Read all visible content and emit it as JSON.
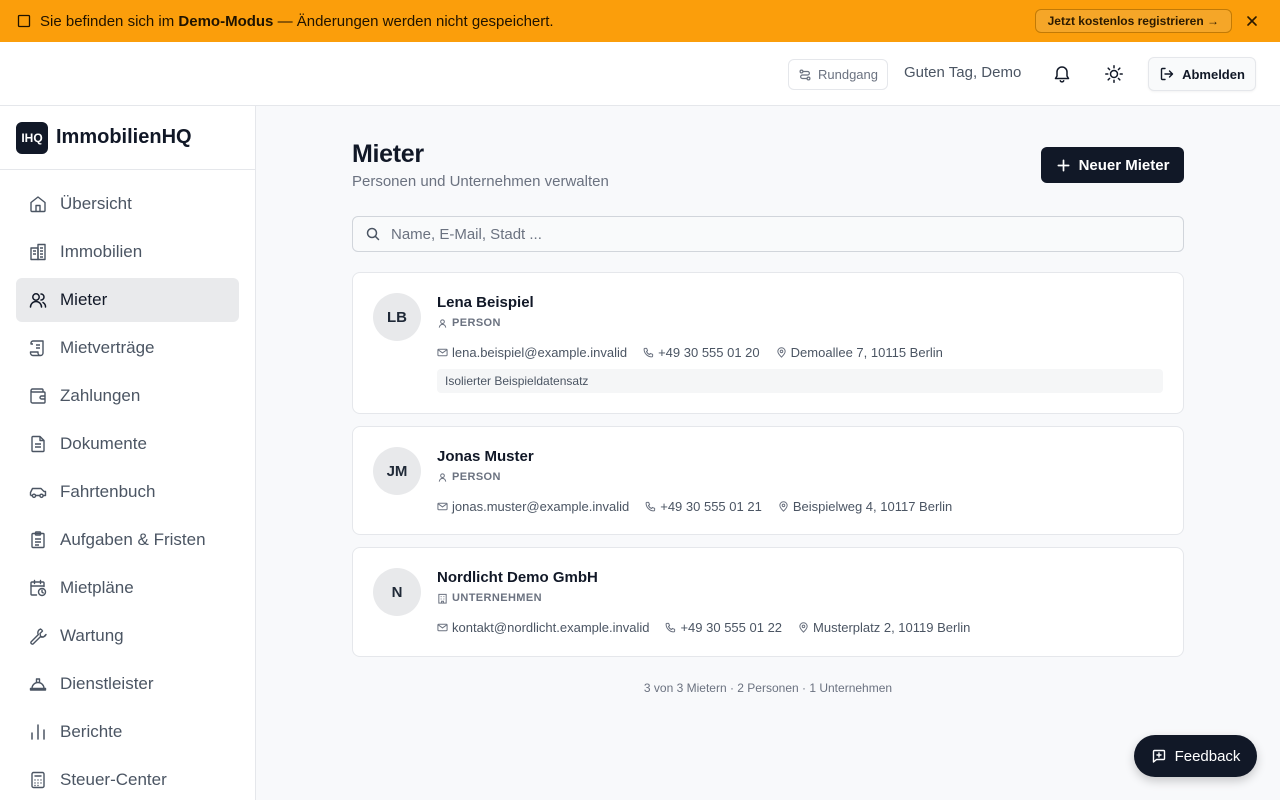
{
  "banner": {
    "prefix": "Sie befinden sich im ",
    "mode": "Demo-Modus",
    "suffix": " — Änderungen werden nicht gespeichert.",
    "cta": "Jetzt kostenlos registrieren →"
  },
  "header": {
    "tour": "Rundgang",
    "greeting": "Guten Tag, Demo",
    "logout": "Abmelden"
  },
  "sidebar": {
    "logo": "IHQ",
    "brand": "ImmobilienHQ",
    "items": [
      {
        "label": "Übersicht",
        "icon": "home-icon"
      },
      {
        "label": "Immobilien",
        "icon": "building-icon"
      },
      {
        "label": "Mieter",
        "icon": "users-icon",
        "active": true
      },
      {
        "label": "Mietverträge",
        "icon": "scroll-icon"
      },
      {
        "label": "Zahlungen",
        "icon": "wallet-icon"
      },
      {
        "label": "Dokumente",
        "icon": "file-icon"
      },
      {
        "label": "Fahrtenbuch",
        "icon": "car-icon"
      },
      {
        "label": "Aufgaben & Fristen",
        "icon": "clipboard-icon"
      },
      {
        "label": "Mietpläne",
        "icon": "calendar-clock-icon"
      },
      {
        "label": "Wartung",
        "icon": "wrench-icon"
      },
      {
        "label": "Dienstleister",
        "icon": "hardhat-icon"
      },
      {
        "label": "Berichte",
        "icon": "chart-icon"
      },
      {
        "label": "Steuer-Center",
        "icon": "calculator-icon"
      }
    ]
  },
  "main": {
    "title": "Mieter",
    "subtitle": "Personen und Unternehmen verwalten",
    "new_button": "Neuer Mieter",
    "search_placeholder": "Name, E-Mail, Stadt ...",
    "tenants": [
      {
        "initials": "LB",
        "name": "Lena Beispiel",
        "type": "PERSON",
        "email": "lena.beispiel@example.invalid",
        "phone": "+49 30 555 01 20",
        "address": "Demoallee 7, 10115 Berlin",
        "note": "Isolierter Beispieldatensatz"
      },
      {
        "initials": "JM",
        "name": "Jonas Muster",
        "type": "PERSON",
        "email": "jonas.muster@example.invalid",
        "phone": "+49 30 555 01 21",
        "address": "Beispielweg 4, 10117 Berlin"
      },
      {
        "initials": "N",
        "name": "Nordlicht Demo GmbH",
        "type": "UNTERNEHMEN",
        "email": "kontakt@nordlicht.example.invalid",
        "phone": "+49 30 555 01 22",
        "address": "Musterplatz 2, 10119 Berlin"
      }
    ],
    "summary": "3 von 3 Mietern · 2 Personen · 1 Unternehmen"
  },
  "feedback": "Feedback"
}
